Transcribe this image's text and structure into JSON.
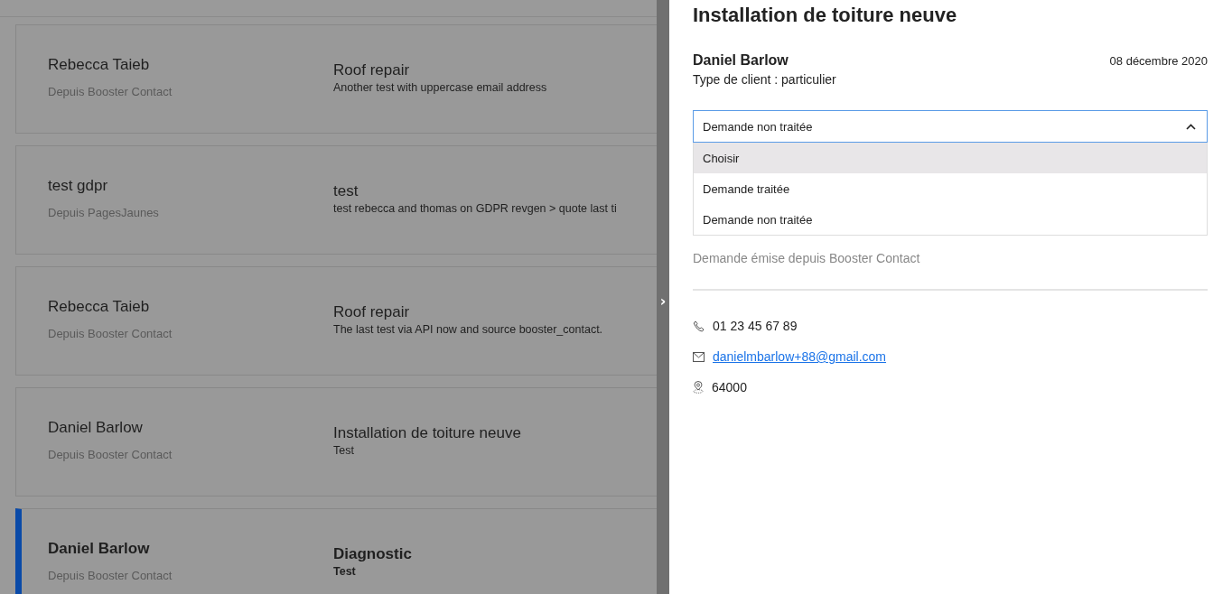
{
  "requests": [
    {
      "name": "Rebecca Taieb",
      "source": "Depuis Booster Contact",
      "title": "Roof repair",
      "description": "Another test with uppercase email address",
      "selected": false
    },
    {
      "name": "test gdpr",
      "source": "Depuis PagesJaunes",
      "title": "test",
      "description": "test rebecca and thomas on GDPR revgen > quote last ti",
      "selected": false
    },
    {
      "name": "Rebecca Taieb",
      "source": "Depuis Booster Contact",
      "title": "Roof repair",
      "description": "The last test via API now and source booster_contact.",
      "selected": false
    },
    {
      "name": "Daniel Barlow",
      "source": "Depuis Booster Contact",
      "title": "Installation de toiture neuve",
      "description": "Test",
      "selected": false
    },
    {
      "name": "Daniel Barlow",
      "source": "Depuis Booster Contact",
      "title": "Diagnostic",
      "description": "Test",
      "selected": true
    }
  ],
  "panel_toggle": "›",
  "detail": {
    "title": "Installation de toiture neuve",
    "client_name": "Daniel Barlow",
    "date": "08 décembre 2020",
    "client_type": "Type de client : particulier",
    "status_select": {
      "value": "Demande non traitée",
      "expanded": true,
      "options": [
        {
          "label": "Choisir",
          "highlighted": true
        },
        {
          "label": "Demande traitée",
          "highlighted": false
        },
        {
          "label": "Demande non traitée",
          "highlighted": false
        }
      ]
    },
    "origin": "Demande émise depuis Booster Contact",
    "phone": "01 23 45 67 89",
    "email": " danielmbarlow+88@gmail.com",
    "postal_code": "64000"
  }
}
